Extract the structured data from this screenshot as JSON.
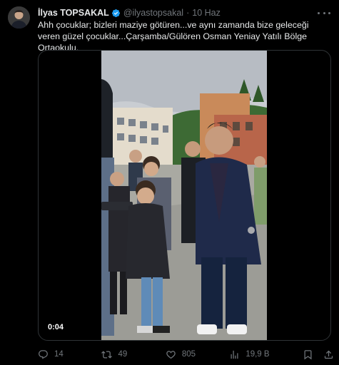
{
  "author": {
    "name": "İlyas TOPSAKAL",
    "handle": "@ilyastopsakal",
    "separator": "·",
    "time": "10 Haz"
  },
  "tweet": {
    "text": "Ahh çocuklar; bizleri maziye götüren...ve aynı zamanda bize geleceği veren güzel çocuklar...Çarşamba/Gülören Osman Yeniay Yatılı Bölge Ortaokulu."
  },
  "video": {
    "duration": "0:04"
  },
  "actions": {
    "replies": "14",
    "retweets": "49",
    "likes": "805",
    "views": "19,9 B"
  },
  "colors": {
    "background": "#000000",
    "text": "#e7e9ea",
    "muted": "#71767b",
    "verified": "#1d9bf0",
    "border": "#2f3336"
  },
  "icons": [
    "verified-badge-icon",
    "more-icon",
    "reply-icon",
    "retweet-icon",
    "like-icon",
    "views-icon",
    "bookmark-icon",
    "share-icon"
  ]
}
